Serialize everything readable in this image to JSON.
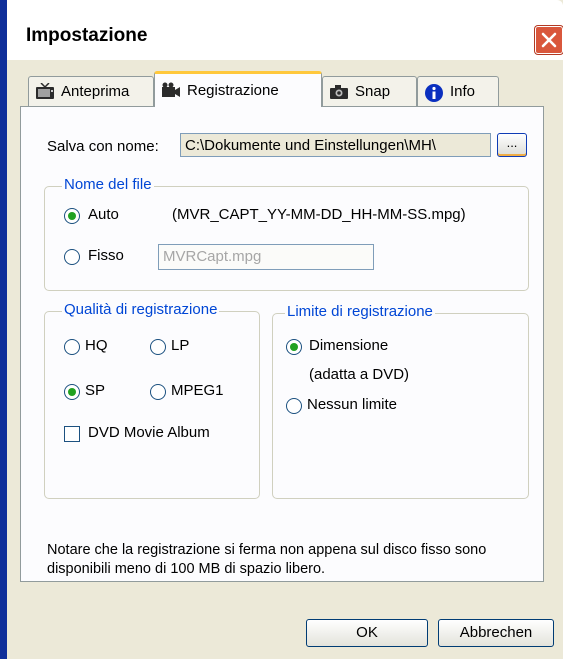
{
  "window": {
    "title": "Impostazione"
  },
  "tabs": [
    {
      "label": "Anteprima",
      "icon": "tv-icon",
      "active": false
    },
    {
      "label": "Registrazione",
      "icon": "camera-icon",
      "active": true
    },
    {
      "label": "Snap",
      "icon": "photo-camera-icon",
      "active": false
    },
    {
      "label": "Info",
      "icon": "info-icon",
      "active": false
    }
  ],
  "save_as": {
    "label": "Salva con nome:",
    "value": "C:\\Dokumente und Einstellungen\\MH\\",
    "browse_label": "..."
  },
  "filename_group": {
    "title": "Nome del file",
    "auto_label": "Auto",
    "auto_pattern": "(MVR_CAPT_YY-MM-DD_HH-MM-SS.mpg)",
    "fixed_label": "Fisso",
    "fixed_placeholder": "MVRCapt.mpg",
    "selected": "Auto"
  },
  "quality_group": {
    "title": "Qualità di registrazione",
    "options": [
      "HQ",
      "LP",
      "SP",
      "MPEG1"
    ],
    "selected": "SP",
    "dvd_album_label": "DVD Movie Album",
    "dvd_album_checked": false
  },
  "limit_group": {
    "title": "Limite di registrazione",
    "size_label": "Dimensione",
    "size_sub": "(adatta a DVD)",
    "none_label": "Nessun limite",
    "selected": "Dimensione"
  },
  "note": "Notare che la registrazione si ferma non appena sul disco fisso sono disponibili meno di 100 MB di spazio libero.",
  "buttons": {
    "ok": "OK",
    "cancel": "Abbrechen"
  },
  "colors": {
    "accent": "#0046d5",
    "close": "#d9573c",
    "tab_highlight": "#ffc83c",
    "radio_dot": "#21a121"
  }
}
